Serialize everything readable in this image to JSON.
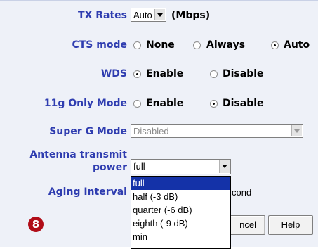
{
  "tx_rates": {
    "label": "TX Rates",
    "value": "Auto",
    "unit": "(Mbps)"
  },
  "cts_mode": {
    "label": "CTS mode",
    "options": [
      "None",
      "Always",
      "Auto"
    ],
    "selected": "Auto"
  },
  "wds": {
    "label": "WDS",
    "options": [
      "Enable",
      "Disable"
    ],
    "selected": "Enable"
  },
  "only_11g": {
    "label": "11g Only Mode",
    "options": [
      "Enable",
      "Disable"
    ],
    "selected": "Disable"
  },
  "super_g": {
    "label": "Super G Mode",
    "value": "Disabled",
    "disabled": true
  },
  "antenna": {
    "label_line1": "Antenna transmit",
    "label_line2": "power",
    "value": "full",
    "options": [
      "full",
      "half (-3 dB)",
      "quarter (-6 dB)",
      "eighth (-9 dB)",
      "min"
    ],
    "highlighted": "full"
  },
  "aging": {
    "label": "Aging Interval",
    "unit_partial": "cond"
  },
  "buttons": {
    "cancel_partial": "ncel",
    "help": "Help"
  },
  "callout": {
    "number": "8",
    "color": "#b10d18"
  },
  "colors": {
    "label": "#2f3db0",
    "panel": "#eef1f8",
    "highlight": "#1432a8"
  }
}
